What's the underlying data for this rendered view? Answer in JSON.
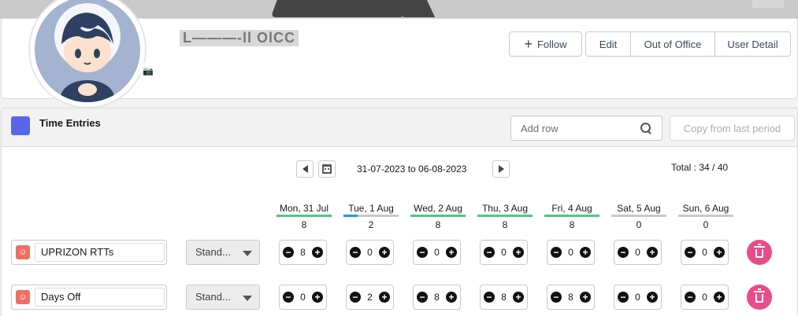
{
  "profile": {
    "name": "L———-ll OlCC",
    "buttons": {
      "follow": "Follow",
      "edit": "Edit",
      "out_of_office": "Out of Office",
      "user_detail": "User Detail"
    }
  },
  "time_entries": {
    "title": "Time Entries",
    "add_row_placeholder": "Add row",
    "copy_button": "Copy from last period",
    "date_range": "31-07-2023 to 06-08-2023",
    "total": "Total : 34 / 40",
    "days": [
      {
        "label": "Mon, 31 Jul",
        "hours": "8",
        "color": "#4bca81",
        "fill": 1.0
      },
      {
        "label": "Tue, 1 Aug",
        "hours": "2",
        "color": "#1b96ff",
        "fill": 0.25
      },
      {
        "label": "Wed, 2 Aug",
        "hours": "8",
        "color": "#4bca81",
        "fill": 1.0
      },
      {
        "label": "Thu, 3 Aug",
        "hours": "8",
        "color": "#4bca81",
        "fill": 1.0
      },
      {
        "label": "Fri, 4 Aug",
        "hours": "8",
        "color": "#4bca81",
        "fill": 1.0
      },
      {
        "label": "Sat, 5 Aug",
        "hours": "0",
        "color": "#c9c9c9",
        "fill": 0
      },
      {
        "label": "Sun, 6 Aug",
        "hours": "0",
        "color": "#c9c9c9",
        "fill": 0
      }
    ],
    "rows": [
      {
        "project": "UPRIZON RTTs",
        "type": "Stand...",
        "values": [
          "8",
          "0",
          "0",
          "0",
          "0",
          "0",
          "0"
        ]
      },
      {
        "project": "Days Off",
        "type": "Stand...",
        "values": [
          "0",
          "2",
          "8",
          "8",
          "8",
          "0",
          "0"
        ]
      }
    ],
    "stepper_minus": "−",
    "stepper_plus": "+"
  }
}
